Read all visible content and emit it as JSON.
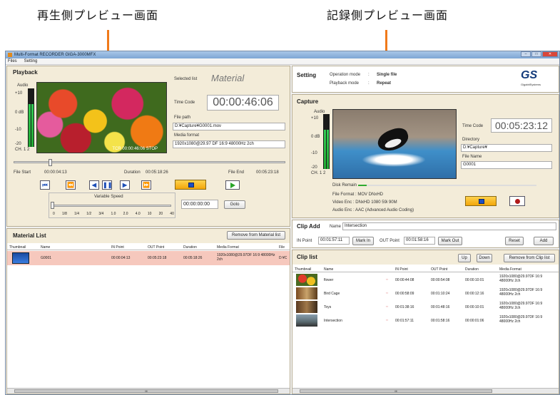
{
  "annotations": {
    "left": "再生側プレビュー画面",
    "right": "記録側プレビュー画面"
  },
  "window": {
    "title": "Multi-Format RECORDER   GIGA-3000MFX"
  },
  "menu": [
    "Files",
    "Setting"
  ],
  "playback": {
    "title": "Playback",
    "selected_list_label": "Selected list",
    "selected_list_value": "Material",
    "audio_label": "Audio",
    "db_labels": [
      "+10",
      "0 dB",
      "-10",
      "-20"
    ],
    "ch_label": "CH. 1 2",
    "overlay": "TCR 00:00:46:06  STOP",
    "timecode_label": "Time Code",
    "timecode": "00:00:46:06",
    "filepath_label": "File path",
    "filepath": "D:¥Capture¥G0001.mov",
    "media_format_label": "Media format",
    "media_format": "1920x1080@29.97 DF 16:9 48000Hz 2ch",
    "file_start_label": "File Start",
    "file_start": "00:00:04:13",
    "duration_label": "Duration",
    "duration": "00:05:18:26",
    "file_end_label": "File End",
    "file_end": "00:05:23:18",
    "variable_speed_label": "Variable Speed",
    "speed_ticks": [
      "0",
      "1/8",
      "1/4",
      "1/2",
      "3/4",
      "1.0",
      "2.0",
      "4.0",
      "10",
      "20",
      "40"
    ],
    "goto_time": "00:00:00:00",
    "goto_label": "Goto"
  },
  "material_list": {
    "title": "Material List",
    "remove_label": "Remove from Material list",
    "headers": [
      "Thumbnail",
      "Name",
      "IN Point",
      "OUT Point",
      "Duration",
      "Media Format",
      "File"
    ],
    "rows": [
      {
        "name": "G0001",
        "in": "00:00:04:13",
        "out": "00:05:23:18",
        "duration": "00:05:18:26",
        "format": "1920x1080@29.97DF 16:9 48000Hz 2ch",
        "file": "D:¥C"
      }
    ],
    "scroll_mid": "III"
  },
  "setting": {
    "title": "Setting",
    "operation_label": "Operation mode",
    "operation_value": "Single file",
    "playback_label": "Playback mode",
    "playback_value": "Repeat",
    "logo_text": "GigabitSystems"
  },
  "capture": {
    "title": "Capture",
    "audio_label": "Audio",
    "db_labels": [
      "+10",
      "0 dB",
      "-10",
      "-20"
    ],
    "ch_label": "CH. 1 2",
    "timecode_label": "Time Code",
    "timecode": "00:05:23:12",
    "directory_label": "Directory",
    "directory": "D:¥Capture¥",
    "filename_label": "File Name",
    "filename": "G0001",
    "disk_remain_label": "Disk Remain",
    "file_format": "File Format  :  MOV DNxHD",
    "video_enc": "Video Enc  :  DNxHD 1080 59i 90M",
    "audio_enc": "Audio Enc  :  AAC (Advanced Audio Coding)"
  },
  "clip_add": {
    "title": "Clip Add",
    "name_label": "Name",
    "name_value": "Intersection",
    "in_label": "IN Point",
    "in_value": "00:01:57:11",
    "mark_in": "Mark In",
    "out_label": "OUT Point",
    "out_value": "00:01:58:16",
    "mark_out": "Mark Out",
    "reset": "Reset",
    "add": "Add"
  },
  "clip_list": {
    "title": "Clip list",
    "up": "Up",
    "down": "Down",
    "remove": "Remove from Clip list",
    "headers": [
      "Thumbnail",
      "Name",
      "IN Point",
      "OUT Point",
      "Duration",
      "Media Format"
    ],
    "rows": [
      {
        "name": "flower",
        "in": "00:00:44:08",
        "out": "00:00:54:08",
        "duration": "00:00:10:01",
        "format": "1920x1080@29.97DF 16:9 48000Hz 2ch"
      },
      {
        "name": "Bird Cage",
        "in": "00:00:58:09",
        "out": "00:01:10:24",
        "duration": "00:00:12:16",
        "format": "1920x1080@29.97DF 16:9 48000Hz 2ch"
      },
      {
        "name": "Toys",
        "in": "00:01:38:16",
        "out": "00:01:48:16",
        "duration": "00:00:10:01",
        "format": "1920x1080@29.97DF 16:9 48000Hz 2ch"
      },
      {
        "name": "Intersection",
        "in": "00:01:57:11",
        "out": "00:01:58:16",
        "duration": "00:00:01:06",
        "format": "1920x1080@29.97DF 16:9 48000Hz 2ch"
      }
    ],
    "scroll_mid": "III"
  }
}
